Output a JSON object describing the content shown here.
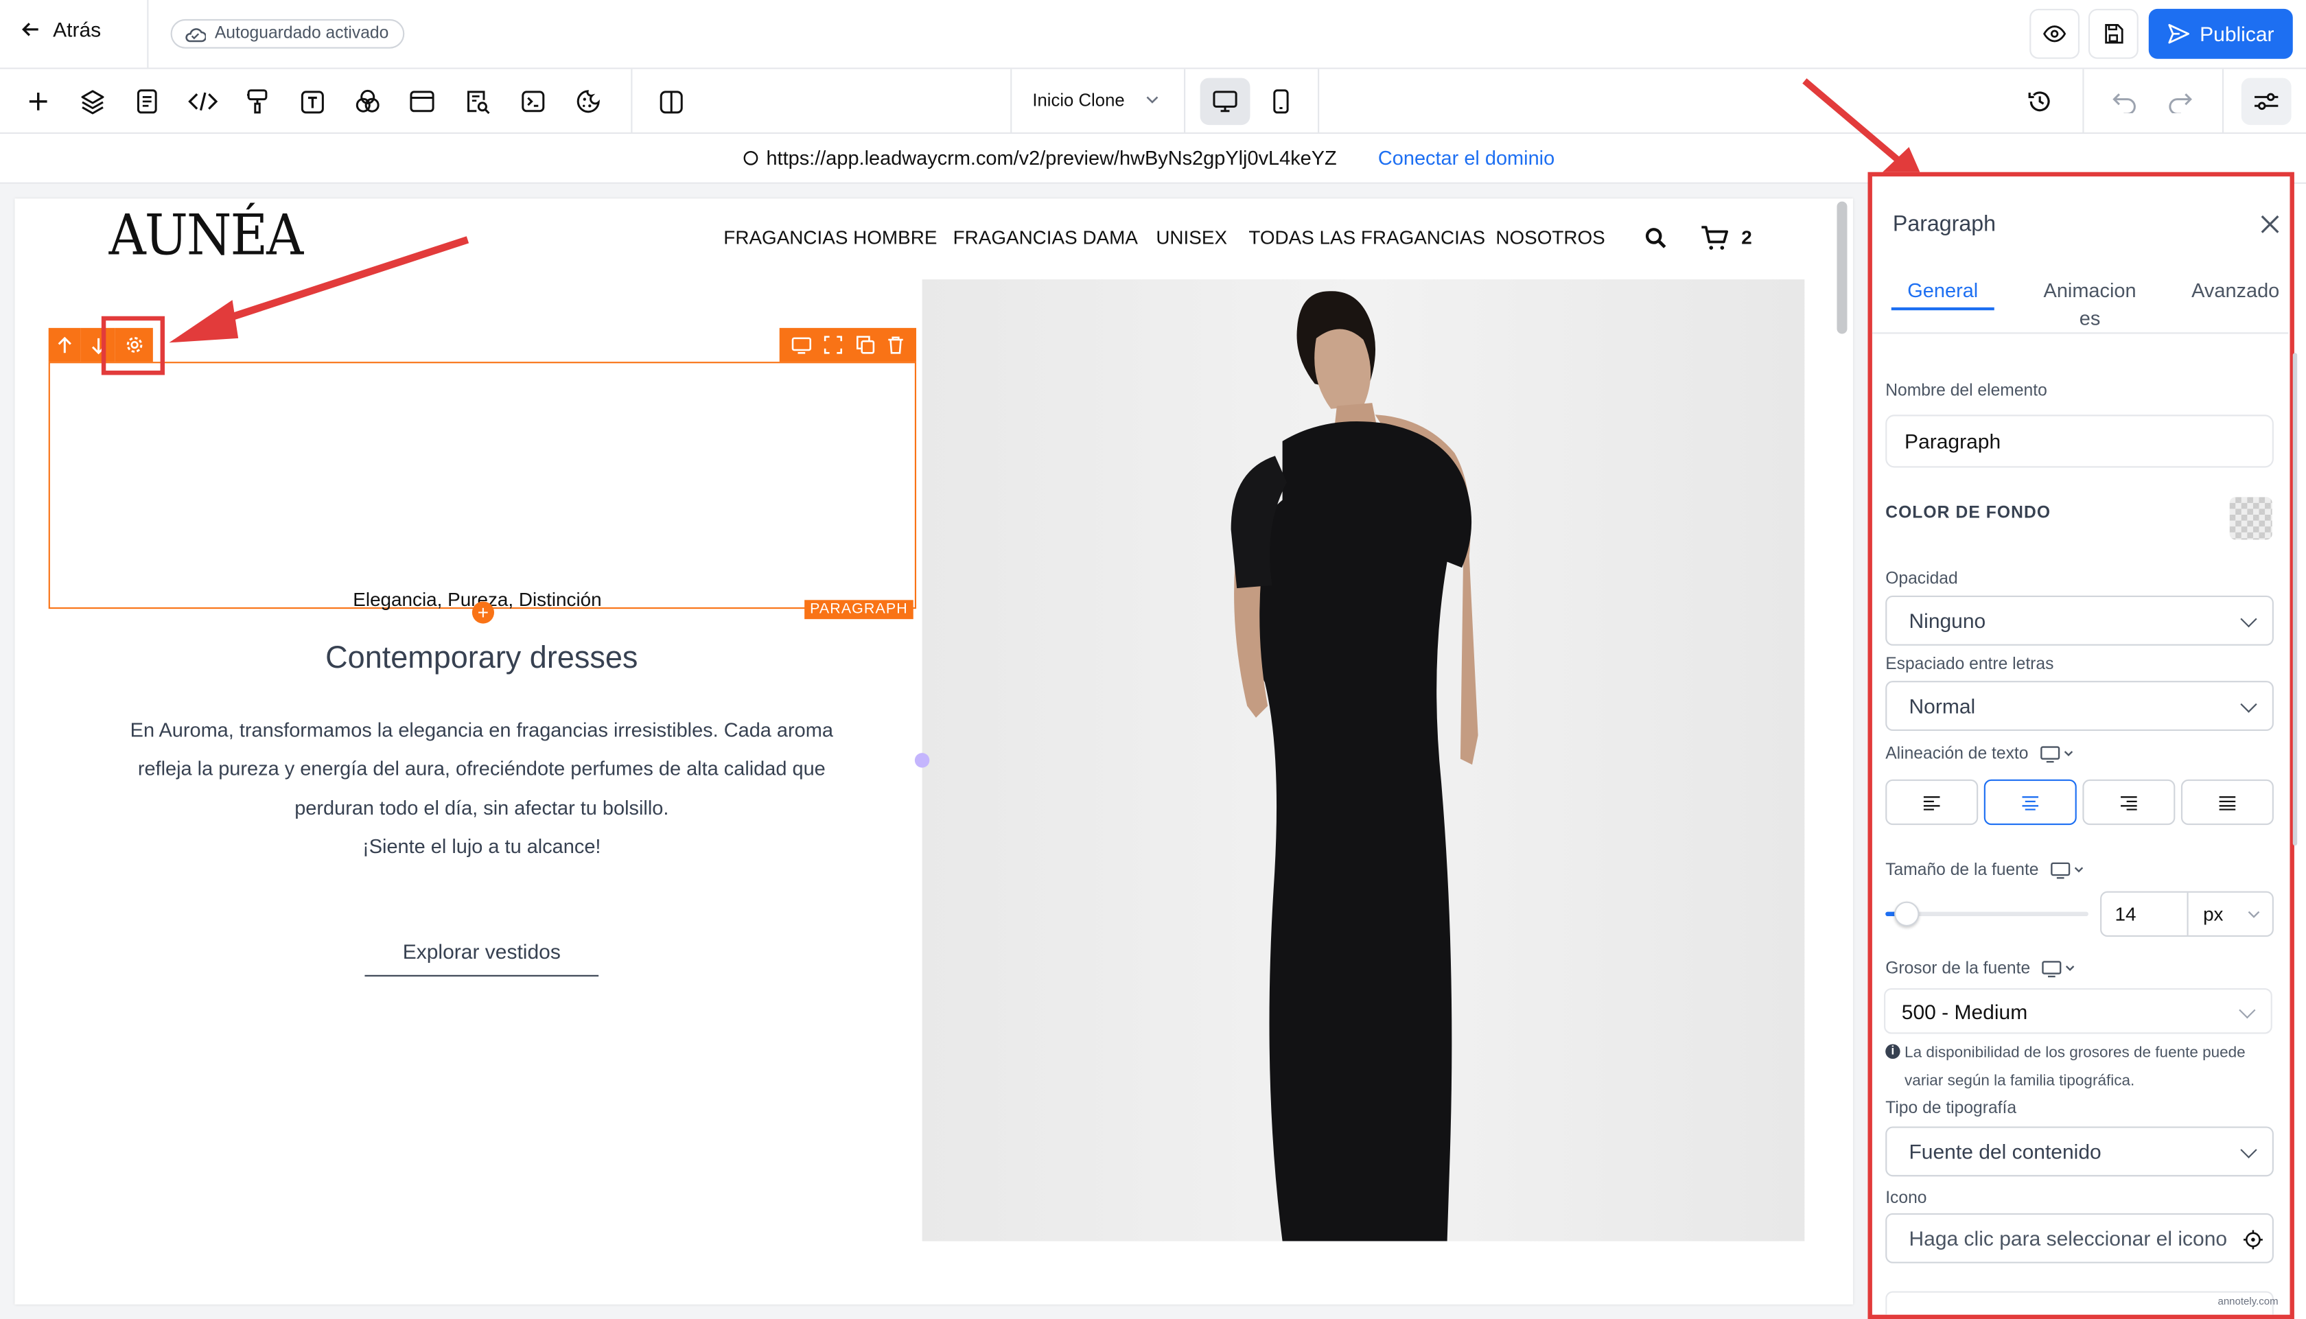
{
  "header": {
    "back_label": "Atrás",
    "autosave_label": "Autoguardado activado",
    "publish_label": "Publicar"
  },
  "toolbar": {
    "page_selector": "Inicio Clone"
  },
  "urlbar": {
    "url": "https://app.leadwaycrm.com/v2/preview/hwByNs2gpYlj0vL4keYZ",
    "connect_label": "Conectar el dominio"
  },
  "site": {
    "logo": "AUNÉA",
    "nav": [
      "FRAGANCIAS HOMBRE",
      "FRAGANCIAS DAMA",
      "UNISEX",
      "TODAS LAS FRAGANCIAS",
      "NOSOTROS"
    ],
    "cart_count": "2",
    "tagline": "Elegancia, Pureza, Distinción",
    "element_tag": "PARAGRAPH",
    "heading": "Contemporary dresses",
    "body_lines": [
      "En Auroma, transformamos la elegancia en fragancias irresistibles. Cada aroma",
      "refleja la pureza y energía del aura, ofreciéndote perfumes de alta calidad que",
      "perduran todo el día, sin afectar tu bolsillo.",
      "¡Siente el lujo a tu alcance!"
    ],
    "cta_label": "Explorar vestidos"
  },
  "panel": {
    "title": "Paragraph",
    "tabs": [
      "General",
      "Animacion es",
      "Avanzado"
    ],
    "element_name_label": "Nombre del elemento",
    "element_name_value": "Paragraph",
    "bg_color_label": "COLOR DE FONDO",
    "opacity_label": "Opacidad",
    "opacity_value": "Ninguno",
    "letter_spacing_label": "Espaciado entre letras",
    "letter_spacing_value": "Normal",
    "text_align_label": "Alineación de texto",
    "font_size_label": "Tamaño de la fuente",
    "font_size_value": "14",
    "font_size_unit": "px",
    "font_size_slider_fraction": 0.1,
    "font_weight_label": "Grosor de la fuente",
    "font_weight_value": "500 - Medium",
    "font_weight_note": "La disponibilidad de los grosores de fuente puede variar según la familia tipográfica.",
    "typography_label": "Tipo de tipografía",
    "typography_value": "Fuente del contenido",
    "icon_label": "Icono",
    "icon_placeholder": "Haga clic para seleccionar el icono"
  },
  "watermark": "annotely.com",
  "colors": {
    "accent": "#1d6ff2",
    "selection": "#f97316",
    "highlight": "#e23b3b"
  }
}
